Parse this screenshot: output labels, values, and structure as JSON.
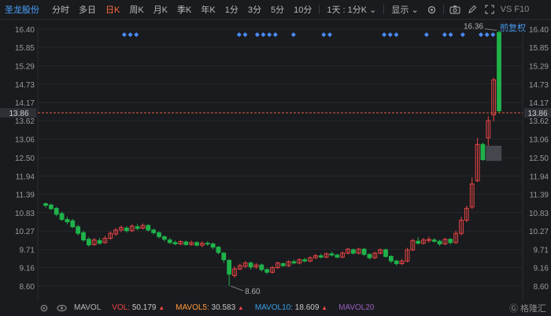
{
  "toolbar": {
    "stock_name": "圣龙股份",
    "tabs": [
      "分时",
      "多日",
      "日K",
      "周K",
      "月K",
      "季K",
      "年K",
      "1分",
      "3分",
      "5分",
      "10分"
    ],
    "active_tab": "日K",
    "period_dropdown": "1天 : 1分K",
    "display_dropdown": "显示",
    "vs_label": "VS",
    "f10_label": "F10"
  },
  "chart": {
    "restore_label": "前复权",
    "price_labels": [
      "16.40",
      "15.85",
      "15.29",
      "14.73",
      "14.17",
      "13.62",
      "13.06",
      "12.50",
      "11.94",
      "11.39",
      "10.83",
      "10.27",
      "9.71",
      "9.16",
      "8.60"
    ],
    "current_price": "13.86",
    "max_annotation": "16.36",
    "min_annotation": "8.60",
    "colors": {
      "up": "#e84545",
      "down": "#1fb24a",
      "grid": "#26272b",
      "text": "#9a9a9a",
      "price_line": "#e0603a",
      "diamond": "#4a8cff"
    }
  },
  "chart_data": {
    "type": "candlestick",
    "ylim": [
      8.6,
      16.4
    ],
    "candles": [
      {
        "o": 11.1,
        "c": 11.05,
        "h": 11.14,
        "l": 10.98
      },
      {
        "o": 11.06,
        "c": 10.95,
        "h": 11.1,
        "l": 10.9
      },
      {
        "o": 10.96,
        "c": 10.78,
        "h": 11.0,
        "l": 10.72
      },
      {
        "o": 10.8,
        "c": 10.62,
        "h": 10.86,
        "l": 10.58
      },
      {
        "o": 10.62,
        "c": 10.55,
        "h": 10.7,
        "l": 10.48
      },
      {
        "o": 10.58,
        "c": 10.4,
        "h": 10.64,
        "l": 10.36
      },
      {
        "o": 10.4,
        "c": 10.2,
        "h": 10.46,
        "l": 10.14
      },
      {
        "o": 10.22,
        "c": 10.0,
        "h": 10.28,
        "l": 9.95
      },
      {
        "o": 10.02,
        "c": 9.85,
        "h": 10.08,
        "l": 9.8
      },
      {
        "o": 9.86,
        "c": 10.0,
        "h": 10.06,
        "l": 9.82
      },
      {
        "o": 9.98,
        "c": 9.9,
        "h": 10.06,
        "l": 9.86
      },
      {
        "o": 9.92,
        "c": 10.05,
        "h": 10.12,
        "l": 9.88
      },
      {
        "o": 10.05,
        "c": 10.2,
        "h": 10.26,
        "l": 10.0
      },
      {
        "o": 10.18,
        "c": 10.3,
        "h": 10.36,
        "l": 10.12
      },
      {
        "o": 10.3,
        "c": 10.38,
        "h": 10.44,
        "l": 10.24
      },
      {
        "o": 10.36,
        "c": 10.28,
        "h": 10.42,
        "l": 10.22
      },
      {
        "o": 10.28,
        "c": 10.42,
        "h": 10.48,
        "l": 10.24
      },
      {
        "o": 10.4,
        "c": 10.35,
        "h": 10.48,
        "l": 10.3
      },
      {
        "o": 10.36,
        "c": 10.44,
        "h": 10.5,
        "l": 10.32
      },
      {
        "o": 10.44,
        "c": 10.3,
        "h": 10.48,
        "l": 10.26
      },
      {
        "o": 10.3,
        "c": 10.22,
        "h": 10.35,
        "l": 10.16
      },
      {
        "o": 10.22,
        "c": 10.1,
        "h": 10.26,
        "l": 10.05
      },
      {
        "o": 10.1,
        "c": 10.02,
        "h": 10.14,
        "l": 9.96
      },
      {
        "o": 10.0,
        "c": 9.92,
        "h": 10.06,
        "l": 9.88
      },
      {
        "o": 9.92,
        "c": 9.88,
        "h": 9.98,
        "l": 9.84
      },
      {
        "o": 9.88,
        "c": 9.95,
        "h": 10.0,
        "l": 9.84
      },
      {
        "o": 9.94,
        "c": 9.86,
        "h": 9.98,
        "l": 9.82
      },
      {
        "o": 9.86,
        "c": 9.92,
        "h": 9.98,
        "l": 9.82
      },
      {
        "o": 9.92,
        "c": 9.84,
        "h": 9.96,
        "l": 9.8
      },
      {
        "o": 9.84,
        "c": 9.9,
        "h": 9.96,
        "l": 9.78
      },
      {
        "o": 9.9,
        "c": 9.88,
        "h": 9.96,
        "l": 9.82
      },
      {
        "o": 9.88,
        "c": 9.78,
        "h": 9.92,
        "l": 9.72
      },
      {
        "o": 9.78,
        "c": 9.62,
        "h": 9.82,
        "l": 9.56
      },
      {
        "o": 9.6,
        "c": 9.4,
        "h": 9.64,
        "l": 9.3
      },
      {
        "o": 9.38,
        "c": 8.96,
        "h": 9.42,
        "l": 8.6
      },
      {
        "o": 8.92,
        "c": 9.12,
        "h": 9.2,
        "l": 8.86
      },
      {
        "o": 9.12,
        "c": 9.22,
        "h": 9.28,
        "l": 9.08
      },
      {
        "o": 9.2,
        "c": 9.3,
        "h": 9.36,
        "l": 9.14
      },
      {
        "o": 9.3,
        "c": 9.18,
        "h": 9.34,
        "l": 9.1
      },
      {
        "o": 9.18,
        "c": 9.24,
        "h": 9.3,
        "l": 9.12
      },
      {
        "o": 9.24,
        "c": 9.1,
        "h": 9.28,
        "l": 9.04
      },
      {
        "o": 9.1,
        "c": 9.02,
        "h": 9.14,
        "l": 8.96
      },
      {
        "o": 9.02,
        "c": 9.16,
        "h": 9.2,
        "l": 8.98
      },
      {
        "o": 9.16,
        "c": 9.3,
        "h": 9.34,
        "l": 9.12
      },
      {
        "o": 9.28,
        "c": 9.22,
        "h": 9.32,
        "l": 9.18
      },
      {
        "o": 9.22,
        "c": 9.34,
        "h": 9.38,
        "l": 9.18
      },
      {
        "o": 9.34,
        "c": 9.3,
        "h": 9.4,
        "l": 9.26
      },
      {
        "o": 9.3,
        "c": 9.4,
        "h": 9.44,
        "l": 9.26
      },
      {
        "o": 9.4,
        "c": 9.36,
        "h": 9.46,
        "l": 9.32
      },
      {
        "o": 9.36,
        "c": 9.46,
        "h": 9.5,
        "l": 9.32
      },
      {
        "o": 9.46,
        "c": 9.52,
        "h": 9.58,
        "l": 9.42
      },
      {
        "o": 9.52,
        "c": 9.48,
        "h": 9.58,
        "l": 9.44
      },
      {
        "o": 9.48,
        "c": 9.58,
        "h": 9.62,
        "l": 9.44
      },
      {
        "o": 9.58,
        "c": 9.54,
        "h": 9.64,
        "l": 9.5
      },
      {
        "o": 9.54,
        "c": 9.48,
        "h": 9.58,
        "l": 9.44
      },
      {
        "o": 9.48,
        "c": 9.6,
        "h": 9.66,
        "l": 9.44
      },
      {
        "o": 9.6,
        "c": 9.72,
        "h": 9.76,
        "l": 9.56
      },
      {
        "o": 9.7,
        "c": 9.6,
        "h": 9.74,
        "l": 9.56
      },
      {
        "o": 9.6,
        "c": 9.72,
        "h": 9.76,
        "l": 9.56
      },
      {
        "o": 9.72,
        "c": 9.56,
        "h": 9.76,
        "l": 9.52
      },
      {
        "o": 9.56,
        "c": 9.46,
        "h": 9.6,
        "l": 9.4
      },
      {
        "o": 9.46,
        "c": 9.6,
        "h": 9.64,
        "l": 9.42
      },
      {
        "o": 9.6,
        "c": 9.7,
        "h": 9.74,
        "l": 9.56
      },
      {
        "o": 9.7,
        "c": 9.5,
        "h": 9.74,
        "l": 9.46
      },
      {
        "o": 9.5,
        "c": 9.36,
        "h": 9.54,
        "l": 9.3
      },
      {
        "o": 9.36,
        "c": 9.28,
        "h": 9.4,
        "l": 9.22
      },
      {
        "o": 9.28,
        "c": 9.36,
        "h": 9.42,
        "l": 9.24
      },
      {
        "o": 9.36,
        "c": 9.7,
        "h": 9.76,
        "l": 9.32
      },
      {
        "o": 9.7,
        "c": 9.98,
        "h": 10.04,
        "l": 9.66
      },
      {
        "o": 9.96,
        "c": 9.9,
        "h": 10.08,
        "l": 9.86
      },
      {
        "o": 9.9,
        "c": 10.0,
        "h": 10.06,
        "l": 9.86
      },
      {
        "o": 9.98,
        "c": 10.02,
        "h": 10.1,
        "l": 9.92
      },
      {
        "o": 10.0,
        "c": 9.96,
        "h": 10.06,
        "l": 9.92
      },
      {
        "o": 9.96,
        "c": 9.88,
        "h": 10.0,
        "l": 9.82
      },
      {
        "o": 9.88,
        "c": 10.02,
        "h": 10.06,
        "l": 9.84
      },
      {
        "o": 10.02,
        "c": 9.92,
        "h": 10.06,
        "l": 9.86
      },
      {
        "o": 9.92,
        "c": 10.2,
        "h": 10.28,
        "l": 9.88
      },
      {
        "o": 10.2,
        "c": 10.6,
        "h": 10.7,
        "l": 10.14
      },
      {
        "o": 10.6,
        "c": 10.96,
        "h": 11.04,
        "l": 10.54
      },
      {
        "o": 11.0,
        "c": 11.7,
        "h": 11.9,
        "l": 10.94
      },
      {
        "o": 11.8,
        "c": 12.9,
        "h": 13.1,
        "l": 11.76
      },
      {
        "o": 12.9,
        "c": 12.44,
        "h": 12.96,
        "l": 12.4
      },
      {
        "o": 13.1,
        "c": 13.62,
        "h": 13.76,
        "l": 12.86
      },
      {
        "o": 13.8,
        "c": 14.86,
        "h": 14.92,
        "l": 13.6
      },
      {
        "o": 16.3,
        "c": 13.92,
        "h": 16.36,
        "l": 13.86
      }
    ],
    "marker_dates_note": "",
    "markers": [
      13,
      14,
      15,
      32,
      33,
      35,
      36,
      37,
      38,
      41,
      46,
      47,
      56,
      57,
      58,
      63,
      66,
      67,
      69,
      72,
      73,
      74
    ],
    "indicators": [
      {
        "name": "MAVOL",
        "label": "MAVOL"
      },
      {
        "name": "VOL",
        "label": "VOL:",
        "value": "50.179",
        "arrow": "▲",
        "color": "#e84545"
      },
      {
        "name": "MAVOL5",
        "label": "MAVOL5:",
        "value": "30.583",
        "arrow": "▲",
        "color": "#ff9a3d"
      },
      {
        "name": "MAVOL10",
        "label": "MAVOL10:",
        "value": "18.609",
        "arrow": "▲",
        "color": "#3aa0e8"
      },
      {
        "name": "MAVOL20",
        "label": "MAVOL20",
        "value": "",
        "arrow": "",
        "color": "#9a5fbf"
      }
    ]
  },
  "footer": {
    "watermark": "格隆汇"
  }
}
